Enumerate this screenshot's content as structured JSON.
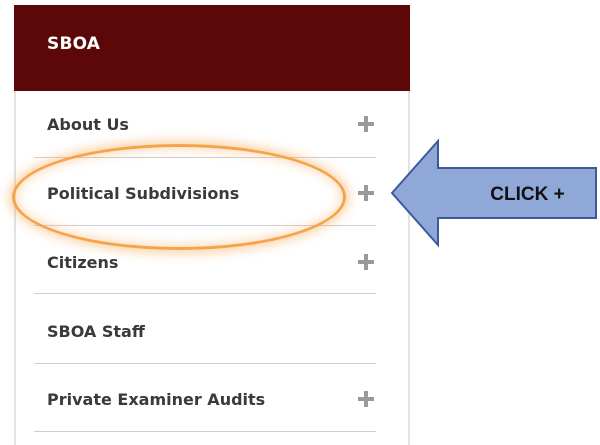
{
  "sidebar": {
    "title": "SBOA",
    "items": [
      {
        "label": "About Us",
        "expandable": true
      },
      {
        "label": "Political Subdivisions",
        "expandable": true
      },
      {
        "label": "Citizens",
        "expandable": true
      },
      {
        "label": "SBOA Staff",
        "expandable": false
      },
      {
        "label": "Private Examiner Audits",
        "expandable": true
      }
    ]
  },
  "annotation": {
    "callout_text": "CLICK +",
    "arrow_fill": "#8fa8d8",
    "highlight_color": "#f6a44c"
  },
  "colors": {
    "header_bg": "#5c0808",
    "label_text": "#3a3a3a",
    "plus_icon": "#9a9a9a",
    "divider": "#cfcfcf"
  }
}
